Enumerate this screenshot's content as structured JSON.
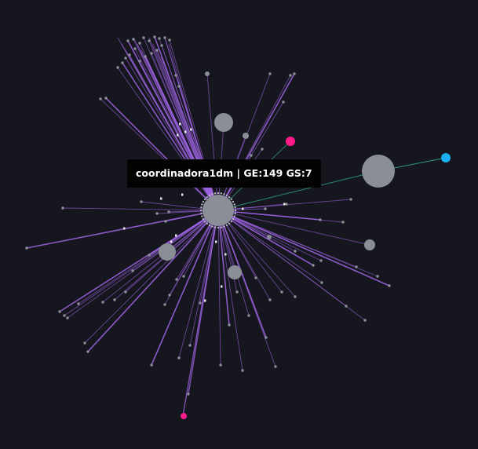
{
  "tooltip": {
    "label": "coordinadora1dm | GE:149 GS:7"
  },
  "colors": {
    "background": "#16161e",
    "edge_purple": "#a066e6",
    "edge_green": "#2fa88a",
    "node_gray": "#8a8e97",
    "node_pink": "#ff1a8c",
    "node_cyan": "#1ab0f0",
    "node_small": "#8c8f96"
  },
  "graph": {
    "hub_count": 1,
    "large_nodes": 5,
    "accent_nodes": [
      "pink",
      "pink",
      "cyan"
    ]
  }
}
